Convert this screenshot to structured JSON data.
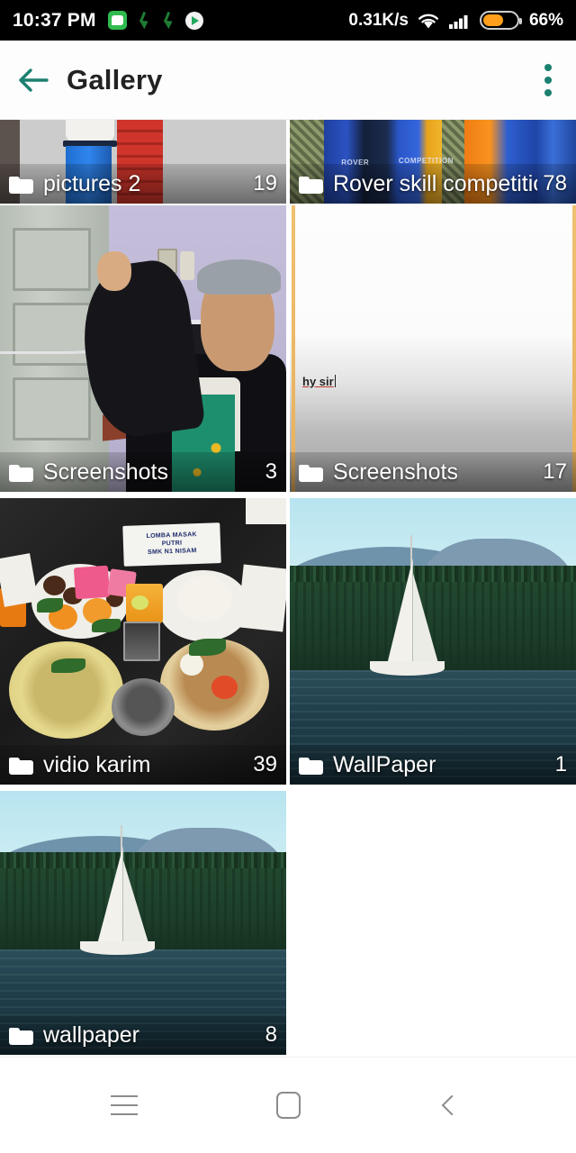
{
  "status_bar": {
    "clock": "10:37 PM",
    "network_speed": "0.31K/s",
    "battery_percent": "66%",
    "battery_level": 66,
    "left_icons": [
      "whatsapp-icon",
      "download-icon",
      "download-icon",
      "play-store-icon"
    ],
    "right_icons": [
      "wifi-icon",
      "signal-icon",
      "battery-icon"
    ],
    "background": "#000000",
    "battery_fill_color": "#ffa01c"
  },
  "app_bar": {
    "title": "Gallery",
    "back_icon": "back-arrow-icon",
    "overflow_icon": "more-vertical-icon",
    "accent_color": "#1b8070",
    "background": "#fdfdfd"
  },
  "gallery": {
    "folders": [
      {
        "name": "pictures 2",
        "count": "19",
        "thumb": "person-blue-trousers"
      },
      {
        "name": "Rover skill competition",
        "count": "78",
        "thumb": "scouts-uniform-group"
      },
      {
        "name": "Screenshots",
        "count": "3",
        "thumb": "person-lavender-room"
      },
      {
        "name": "Screenshots",
        "count": "17",
        "thumb": "white-gradient-note"
      },
      {
        "name": "vidio karim",
        "count": "39",
        "thumb": "food-display-black-cloth"
      },
      {
        "name": "WallPaper",
        "count": "1",
        "thumb": "sailboat-lake"
      },
      {
        "name": "wallpaper",
        "count": "8",
        "thumb": "sailboat-lake"
      }
    ],
    "folder_icon": "folder-icon"
  },
  "thumbnail_text": {
    "screenshot_note": "hy sir",
    "food_sign_line1": "LOMBA MASAK",
    "food_sign_line2": "PUTRI",
    "food_sign_line3": "SMK N1 NISAM",
    "rover_badge1": "ROVER",
    "rover_badge2": "COMPETITION"
  },
  "nav_bar": {
    "recents_icon": "menu-icon",
    "home_icon": "home-square-icon",
    "back_icon": "back-chevron-icon",
    "icon_color": "#8c8c8c"
  }
}
